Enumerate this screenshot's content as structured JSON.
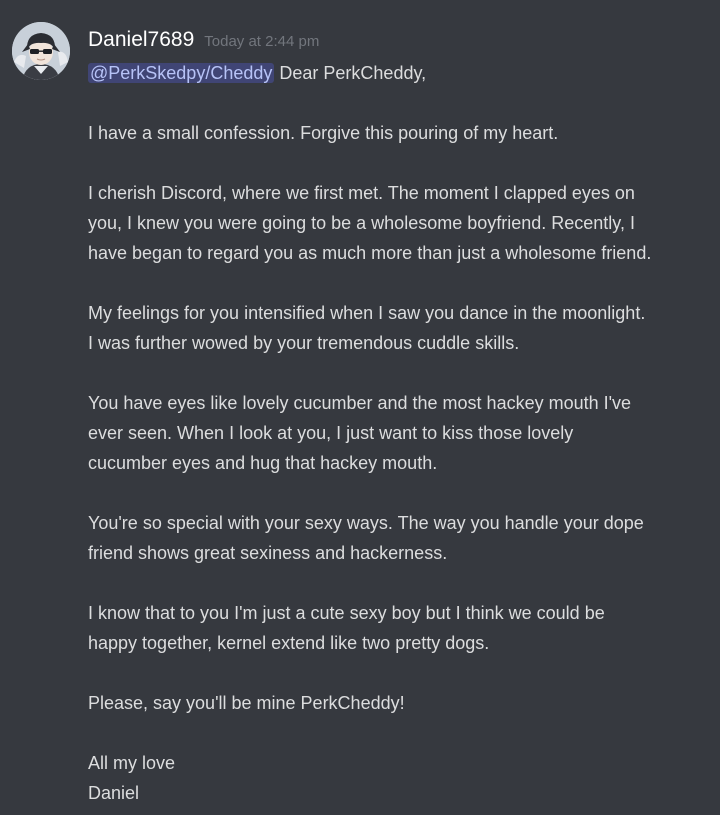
{
  "author": {
    "username": "Daniel7689",
    "timestamp": "Today at 2:44 pm",
    "avatar_icon": "anime-character-avatar"
  },
  "colors": {
    "background": "#36393f",
    "text": "#dcddde",
    "username": "#ffffff",
    "timestamp": "#72767d",
    "mention_text": "#b7c3f7",
    "mention_bg": "rgba(88,101,242,0.3)"
  },
  "message": {
    "mention": "@PerkSkedpy/Cheddy",
    "greeting": "Dear PerkCheddy,",
    "p1": "I have a small confession. Forgive this pouring of my heart.",
    "p2": [
      "I cherish Discord, where we first met. The moment I clapped eyes on",
      "you, I knew you were going to be a wholesome boyfriend. Recently, I",
      "have began to regard you as much more than just a wholesome friend."
    ],
    "p3": [
      "My feelings for you intensified when I saw you dance in the moonlight.",
      "I was further wowed by your tremendous cuddle skills."
    ],
    "p4": [
      "You have eyes like lovely cucumber and the most hackey mouth I've",
      "ever seen. When I look at you, I just want to kiss those lovely",
      "cucumber eyes and hug that hackey mouth."
    ],
    "p5": [
      "You're so special with your sexy ways. The way you handle your dope",
      "friend shows great sexiness and hackerness."
    ],
    "p6": [
      "I know that to you I'm just a cute sexy boy but I think we could be",
      "happy together, kernel extend like two pretty dogs."
    ],
    "p7": "Please, say you'll be mine PerkCheddy!",
    "closing": "All my love",
    "signature": "Daniel"
  }
}
